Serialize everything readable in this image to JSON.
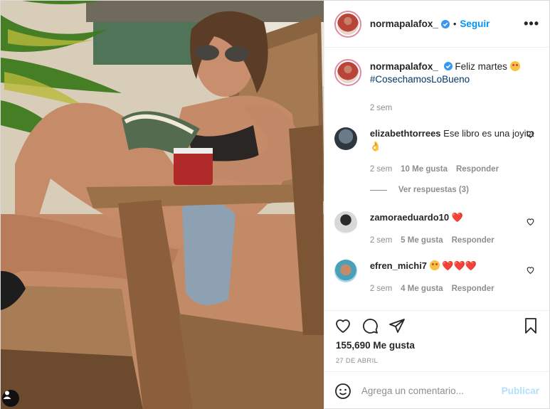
{
  "post": {
    "username": "normapalafox_",
    "follow_label": "Seguir",
    "dot": "•",
    "more_label": "•••"
  },
  "caption": {
    "username": "normapalafox_",
    "text": "Feliz martes",
    "hashtag": "#CosechamosLoBueno",
    "time": "2 sem"
  },
  "comments": [
    {
      "username": "elizabethtorrees",
      "text": "Ese libro es una joyita 👌",
      "time": "2 sem",
      "likes": "10 Me gusta",
      "reply": "Responder",
      "view_replies": "Ver respuestas (3)"
    },
    {
      "username": "zamoraeduardo10",
      "text": "❤️",
      "time": "2 sem",
      "likes": "5 Me gusta",
      "reply": "Responder"
    },
    {
      "username": "efren_michi7",
      "text": "❤️❤️❤️",
      "time": "2 sem",
      "likes": "4 Me gusta",
      "reply": "Responder"
    }
  ],
  "likes_count": "155,690 Me gusta",
  "date": "27 DE ABRIL",
  "add_comment": {
    "placeholder": "Agrega un comentario...",
    "publish_label": "Publicar"
  },
  "colors": {
    "accent": "#0095f6",
    "heart": "#ed4956",
    "muted": "#8e8e8e"
  },
  "icons": [
    "heart-icon",
    "comment-icon",
    "share-icon",
    "bookmark-icon",
    "emoji-icon",
    "verified-icon",
    "user-tag-icon"
  ]
}
